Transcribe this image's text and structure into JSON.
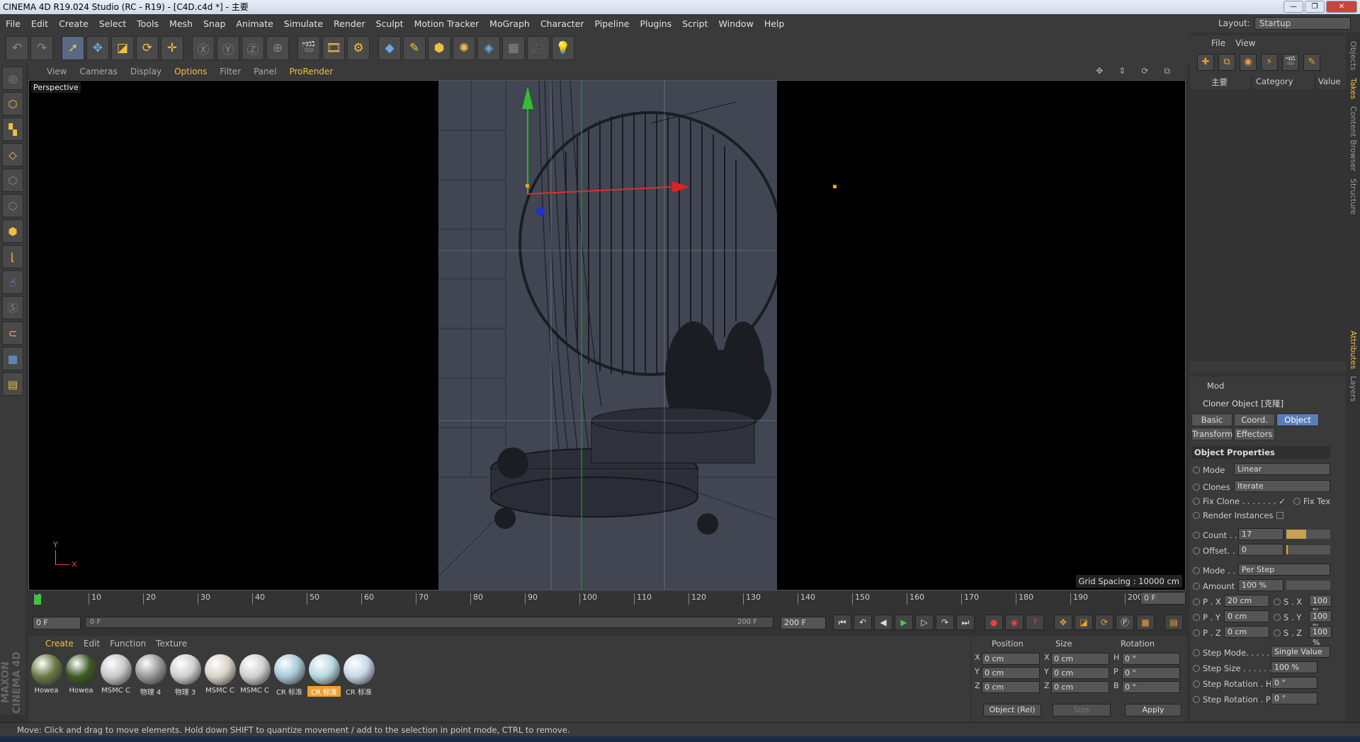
{
  "title": "CINEMA 4D R19.024 Studio (RC - R19) - [C4D.c4d *] - 主要",
  "window_buttons": [
    "—",
    "❐",
    "✕"
  ],
  "menu": [
    "File",
    "Edit",
    "Create",
    "Select",
    "Tools",
    "Mesh",
    "Snap",
    "Animate",
    "Simulate",
    "Render",
    "Sculpt",
    "Motion Tracker",
    "MoGraph",
    "Character",
    "Pipeline",
    "Plugins",
    "Script",
    "Window",
    "Help"
  ],
  "layout": {
    "label": "Layout:",
    "value": "Startup"
  },
  "viewport": {
    "menu": [
      "View",
      "Cameras",
      "Display",
      "Options",
      "Filter",
      "Panel",
      "ProRender"
    ],
    "label": "Perspective",
    "grid_spacing": "Grid Spacing : 10000 cm",
    "axis_y": "Y",
    "axis_x": "X"
  },
  "timeline": {
    "ticks": [
      "0",
      "10",
      "20",
      "30",
      "40",
      "50",
      "60",
      "70",
      "80",
      "90",
      "100",
      "110",
      "120",
      "130",
      "140",
      "150",
      "160",
      "170",
      "180",
      "190",
      "200"
    ],
    "current_frame": "0 F"
  },
  "transport": {
    "start": "0 F",
    "slider_start": "0 F",
    "slider_end": "200 F",
    "end": "200 F"
  },
  "materials": {
    "menu": [
      "Create",
      "Edit",
      "Function",
      "Texture"
    ],
    "items": [
      {
        "name": "Howea",
        "color": "#6b7a45"
      },
      {
        "name": "Howea",
        "color": "#3d5a25"
      },
      {
        "name": "MSMC C",
        "color": "#c8c8c8"
      },
      {
        "name": "物理 4",
        "color": "#9a9a9a"
      },
      {
        "name": "物理 3",
        "color": "#d0d0d0"
      },
      {
        "name": "MSMC C",
        "color": "#d8d2c8"
      },
      {
        "name": "MSMC C",
        "color": "#d0d0d0"
      },
      {
        "name": "CR 标准",
        "color": "#a8c8d8"
      },
      {
        "name": "CR 标准",
        "color": "#b8d8e0",
        "selected": true
      },
      {
        "name": "CR 标准",
        "color": "#c8d8e8"
      }
    ]
  },
  "coords": {
    "headers": [
      "Position",
      "Size",
      "Rotation"
    ],
    "rows": [
      {
        "pl": "X",
        "pv": "0 cm",
        "sl": "X",
        "sv": "0 cm",
        "rl": "H",
        "rv": "0 °"
      },
      {
        "pl": "Y",
        "pv": "0 cm",
        "sl": "Y",
        "sv": "0 cm",
        "rl": "P",
        "rv": "0 °"
      },
      {
        "pl": "Z",
        "pv": "0 cm",
        "sl": "Z",
        "sv": "0 cm",
        "rl": "B",
        "rv": "0 °"
      }
    ],
    "mode": "Object (Rel)",
    "size_mode": "Size",
    "apply": "Apply"
  },
  "status": "Move: Click and drag to move elements. Hold down SHIFT to quantize movement / add to the selection in point mode, CTRL to remove.",
  "maxon": "MAXON CINEMA 4D",
  "objects": {
    "menu": [
      "File",
      "View"
    ],
    "col_name": "主要",
    "col_category": "Category",
    "col_value": "Value"
  },
  "sidetabs": [
    "Objects",
    "Takes",
    "Content Browser",
    "Structure",
    "Attributes",
    "Layers"
  ],
  "attributes": {
    "mode": "Mod",
    "title": "Cloner Object [克隆]",
    "tabs": [
      "Basic",
      "Coord.",
      "Object",
      "Transform",
      "Effectors"
    ],
    "section": "Object Properties",
    "mode_label": "Mode",
    "mode_value": "Linear",
    "clones_label": "Clones",
    "clones_value": "Iterate",
    "fix_clone": "Fix Clone . . . . . . .",
    "fix_clone_check": "✓",
    "fix_tex": "Fix Tex",
    "render_instances": "Render Instances",
    "count_label": "Count . .",
    "count_value": "17",
    "offset_label": "Offset. .",
    "offset_value": "0",
    "mode2_label": "Mode . .",
    "mode2_value": "Per Step",
    "amount_label": "Amount",
    "amount_value": "100 %",
    "px_label": "P . X",
    "px_value": "20 cm",
    "sx_label": "S . X",
    "sx_value": "100 %",
    "py_label": "P . Y",
    "py_value": "0 cm",
    "sy_label": "S . Y",
    "sy_value": "100 %",
    "pz_label": "P . Z",
    "pz_value": "0 cm",
    "sz_label": "S . Z",
    "sz_value": "100 %",
    "step_mode_label": "Step Mode. . . . . . .",
    "step_mode_value": "Single Value",
    "step_size_label": "Step Size . . . . . . .",
    "step_size_value": "100 %",
    "step_rot_h_label": "Step Rotation . H",
    "step_rot_h_value": "0 °",
    "step_rot_p_label": "Step Rotation . P",
    "step_rot_p_value": "0 °"
  }
}
